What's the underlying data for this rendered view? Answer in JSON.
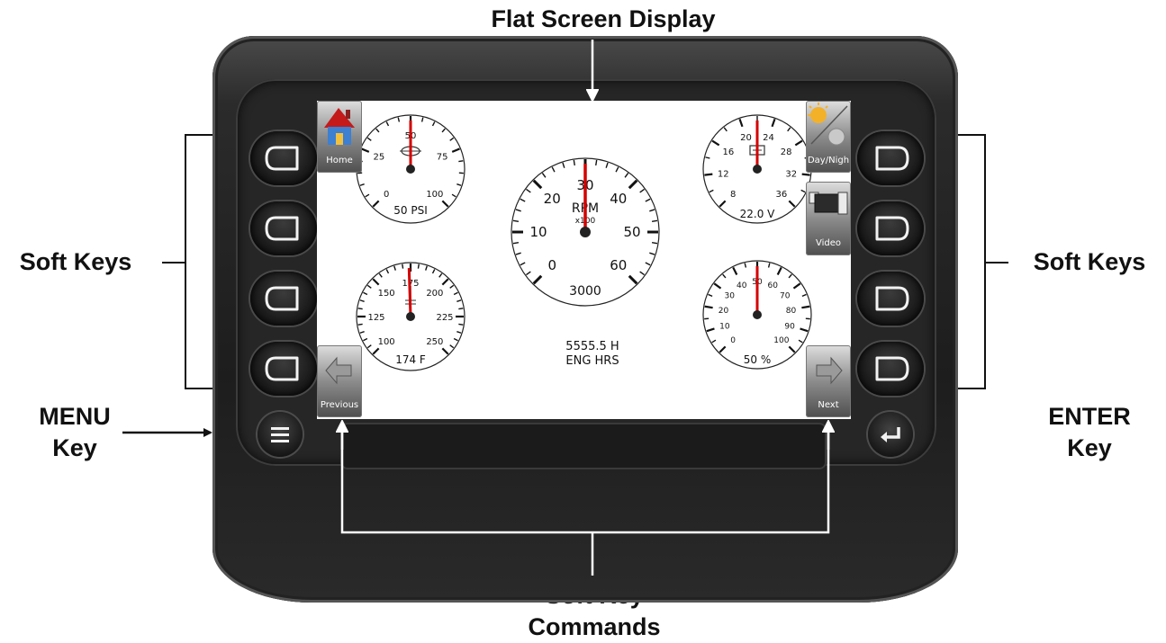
{
  "callouts": {
    "flat_screen": "Flat Screen Display",
    "soft_keys_left": "Soft Keys",
    "soft_keys_right": "Soft Keys",
    "menu_key_line1": "MENU",
    "menu_key_line2": "Key",
    "enter_key_line1": "ENTER",
    "enter_key_line2": "Key",
    "commands_line1": "Soft Key",
    "commands_line2": "Commands"
  },
  "screen_buttons": {
    "home": "Home",
    "day_night": "Day/Nigh",
    "video": "Video",
    "previous": "Previous",
    "next": "Next"
  },
  "engine_hours": {
    "value": "5555.5 H",
    "label": "ENG HRS"
  },
  "gauges": [
    {
      "id": "oil-pressure",
      "icon": "oil-can-icon",
      "readout": "50 PSI",
      "min": 0,
      "max": 100,
      "value": 50,
      "labels": [
        "0",
        "25",
        "50",
        "75",
        "100"
      ]
    },
    {
      "id": "tachometer",
      "title": "RPM",
      "subtitle": "x100",
      "readout": "3000",
      "min": 0,
      "max": 60,
      "value": 30,
      "labels": [
        "0",
        "10",
        "20",
        "30",
        "40",
        "50",
        "60"
      ]
    },
    {
      "id": "voltmeter",
      "icon": "battery-icon",
      "readout": "22.0 V",
      "min": 8,
      "max": 36,
      "value": 22,
      "labels": [
        "8",
        "12",
        "16",
        "20",
        "24",
        "28",
        "32",
        "36"
      ]
    },
    {
      "id": "coolant-temp",
      "icon": "coolant-icon",
      "readout": "174 F",
      "min": 100,
      "max": 250,
      "value": 174,
      "labels": [
        "100",
        "125",
        "150",
        "175",
        "200",
        "225",
        "250"
      ]
    },
    {
      "id": "load-percent",
      "readout": "50 %",
      "min": 0,
      "max": 100,
      "value": 50,
      "labels": [
        "0",
        "10",
        "20",
        "30",
        "40",
        "50",
        "60",
        "70",
        "80",
        "90",
        "100"
      ]
    }
  ],
  "colors": {
    "needle": "#d40000",
    "bezel": "#1d1d1d",
    "screen": "#ffffff",
    "arrow": "#ffffff"
  }
}
